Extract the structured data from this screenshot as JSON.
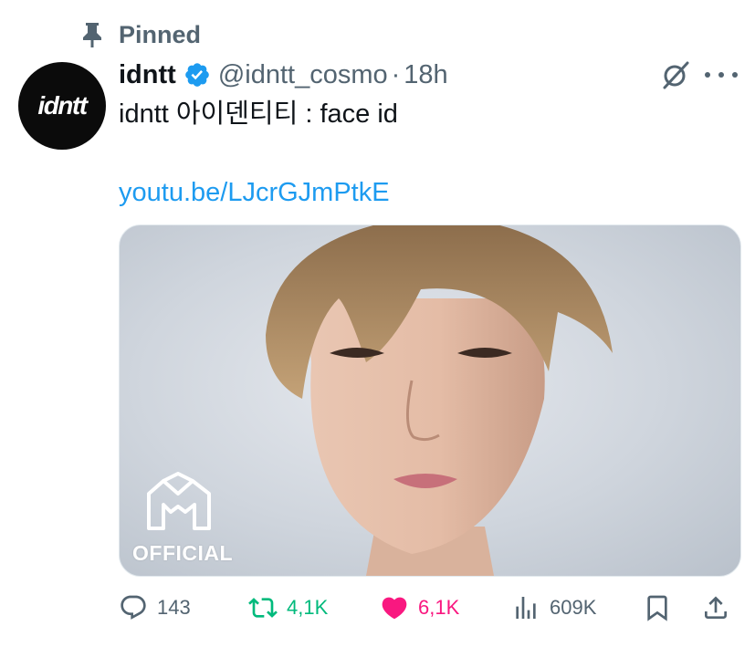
{
  "pinned": {
    "label": "Pinned"
  },
  "author": {
    "avatar_text": "idntt",
    "display_name": "idntt",
    "handle": "@idntt_cosmo",
    "separator": "·",
    "time": "18h"
  },
  "tweet": {
    "text": "idntt 아이덴티티 : face id",
    "link": "youtu.be/LJcrGJmPtkE"
  },
  "media": {
    "badge_label": "OFFICIAL"
  },
  "actions": {
    "replies": "143",
    "retweets": "4,1K",
    "likes": "6,1K",
    "views": "609K"
  },
  "colors": {
    "text_primary": "#0f1419",
    "text_secondary": "#536471",
    "link": "#1d9bf0",
    "verified": "#1d9bf0",
    "retweet_active": "#00ba7c",
    "like_active": "#f91880"
  },
  "icons": {
    "pinned": "pin-icon",
    "verified": "verified-badge-icon",
    "grok": "grok-icon",
    "more": "more-icon",
    "reply": "reply-icon",
    "retweet": "retweet-icon",
    "like": "heart-icon",
    "views": "analytics-icon",
    "bookmark": "bookmark-icon",
    "share": "share-icon"
  }
}
